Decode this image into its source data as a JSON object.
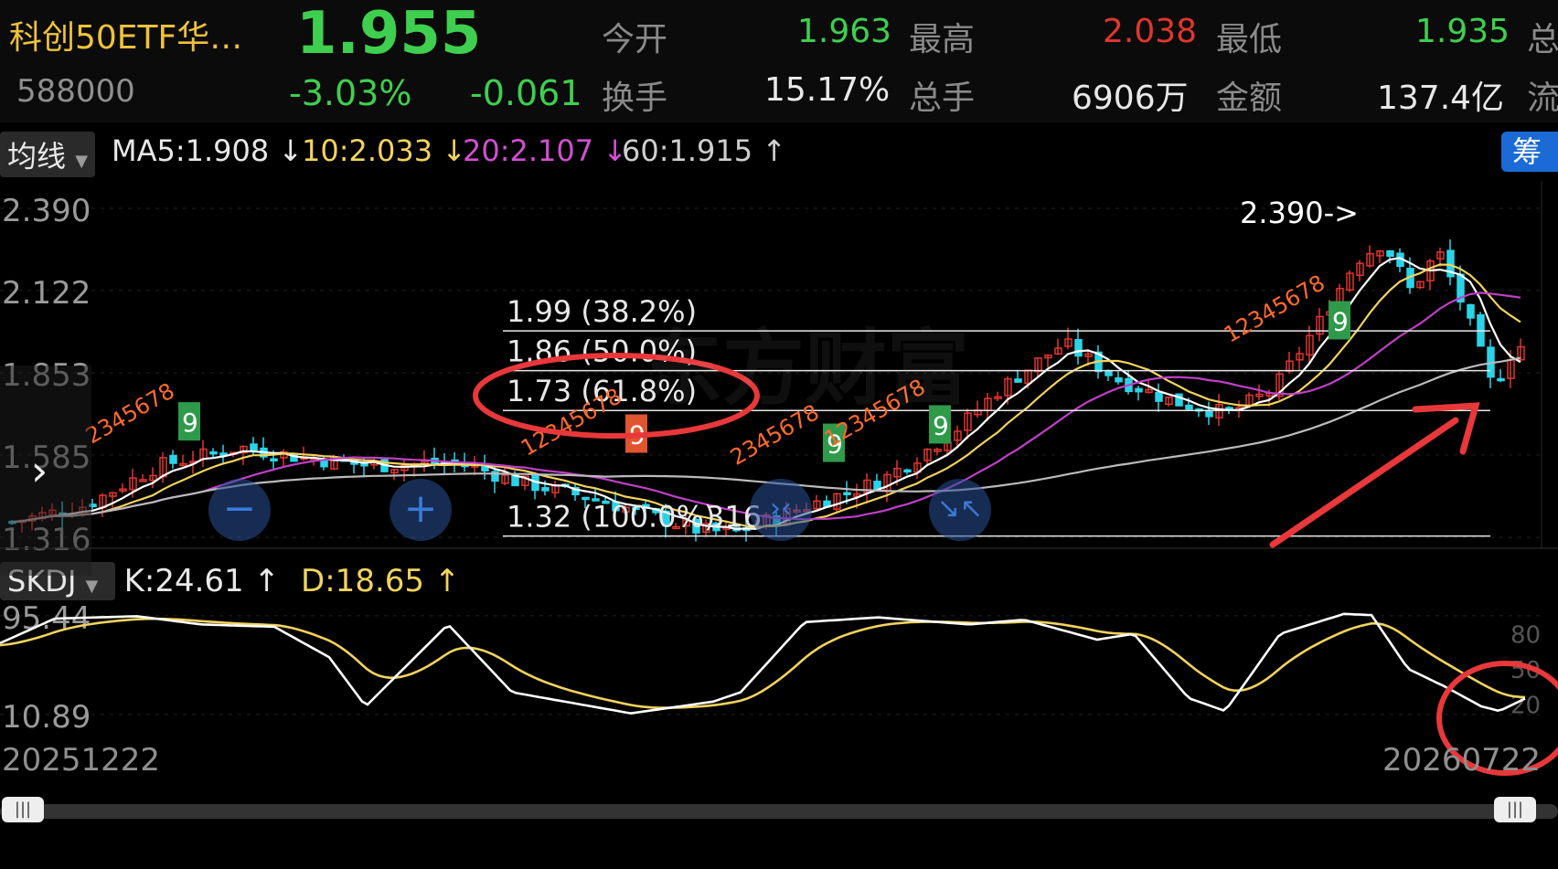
{
  "header": {
    "name": "科创50ETF华…",
    "code": "588000",
    "price": "1.955",
    "change_pct": "-3.03%",
    "change": "-0.061",
    "stats": [
      {
        "label": "今开",
        "value": "1.963",
        "color": "#3fcf4f"
      },
      {
        "label": "最高",
        "value": "2.038",
        "color": "#e0362f"
      },
      {
        "label": "最低",
        "value": "1.935",
        "color": "#3fcf4f"
      },
      {
        "label": "换手",
        "value": "15.17%",
        "color": "#e8e8e8"
      },
      {
        "label": "总手",
        "value": "6906万",
        "color": "#e8e8e8"
      },
      {
        "label": "金额",
        "value": "137.4亿",
        "color": "#e8e8e8"
      }
    ],
    "cut_labels": [
      "总",
      "流"
    ]
  },
  "ma_bar": {
    "selector": "均线",
    "items": [
      {
        "text": "MA5:1.908 ↓",
        "color": "#e8e8e8"
      },
      {
        "text": "10:2.033 ↓",
        "color": "#f2d35c"
      },
      {
        "text": "20:2.107 ↓",
        "color": "#d14fd0"
      },
      {
        "text": "60:1.915 ↑",
        "color": "#cfcfcf"
      }
    ],
    "chip_button": "筹码"
  },
  "chart_data": [
    {
      "type": "candlestick",
      "y_ticks": [
        "2.390",
        "2.122",
        "1.853",
        "1.585",
        "1.316"
      ],
      "ylim": [
        1.316,
        2.39
      ],
      "x_range_labels": [
        "20251222",
        "20260722"
      ],
      "fib_levels": [
        {
          "label": "1.99 (38.2%)",
          "value": 1.99
        },
        {
          "label": "1.86 (50.0%)",
          "value": 1.86
        },
        {
          "label": "1.73 (61.8%)",
          "value": 1.73
        },
        {
          "label": "1.32 (100.0%)",
          "value": 1.32
        }
      ],
      "annotations": {
        "high": "2.390->",
        "low_tail": "316"
      },
      "td_sequences": [
        {
          "digits": "2345678",
          "end": "9"
        },
        {
          "digits": "12345678",
          "end": "9"
        },
        {
          "digits": "2345678",
          "end": "9"
        },
        {
          "digits": "12345678",
          "end": "9"
        },
        {
          "digits": "12345678",
          "end": "9"
        }
      ],
      "colors": {
        "up": "#e0362f",
        "down": "#2ad4e8",
        "ma5": "#ffffff",
        "ma10": "#f2d35c",
        "ma20": "#c040c8",
        "ma60": "#bbbbbb"
      }
    },
    {
      "type": "line",
      "indicator": "SKDJ",
      "series": [
        {
          "name": "K",
          "label": "K:24.61 ↑",
          "value": 24.61,
          "color": "#ffffff"
        },
        {
          "name": "D",
          "label": "D:18.65 ↑",
          "value": 18.65,
          "color": "#f2d35c"
        }
      ],
      "y_ticks": [
        "95.44",
        "10.89"
      ],
      "right_ticks": [
        "80",
        "50",
        "20"
      ],
      "ylim": [
        0,
        100
      ]
    }
  ],
  "watermark": "东方财富"
}
